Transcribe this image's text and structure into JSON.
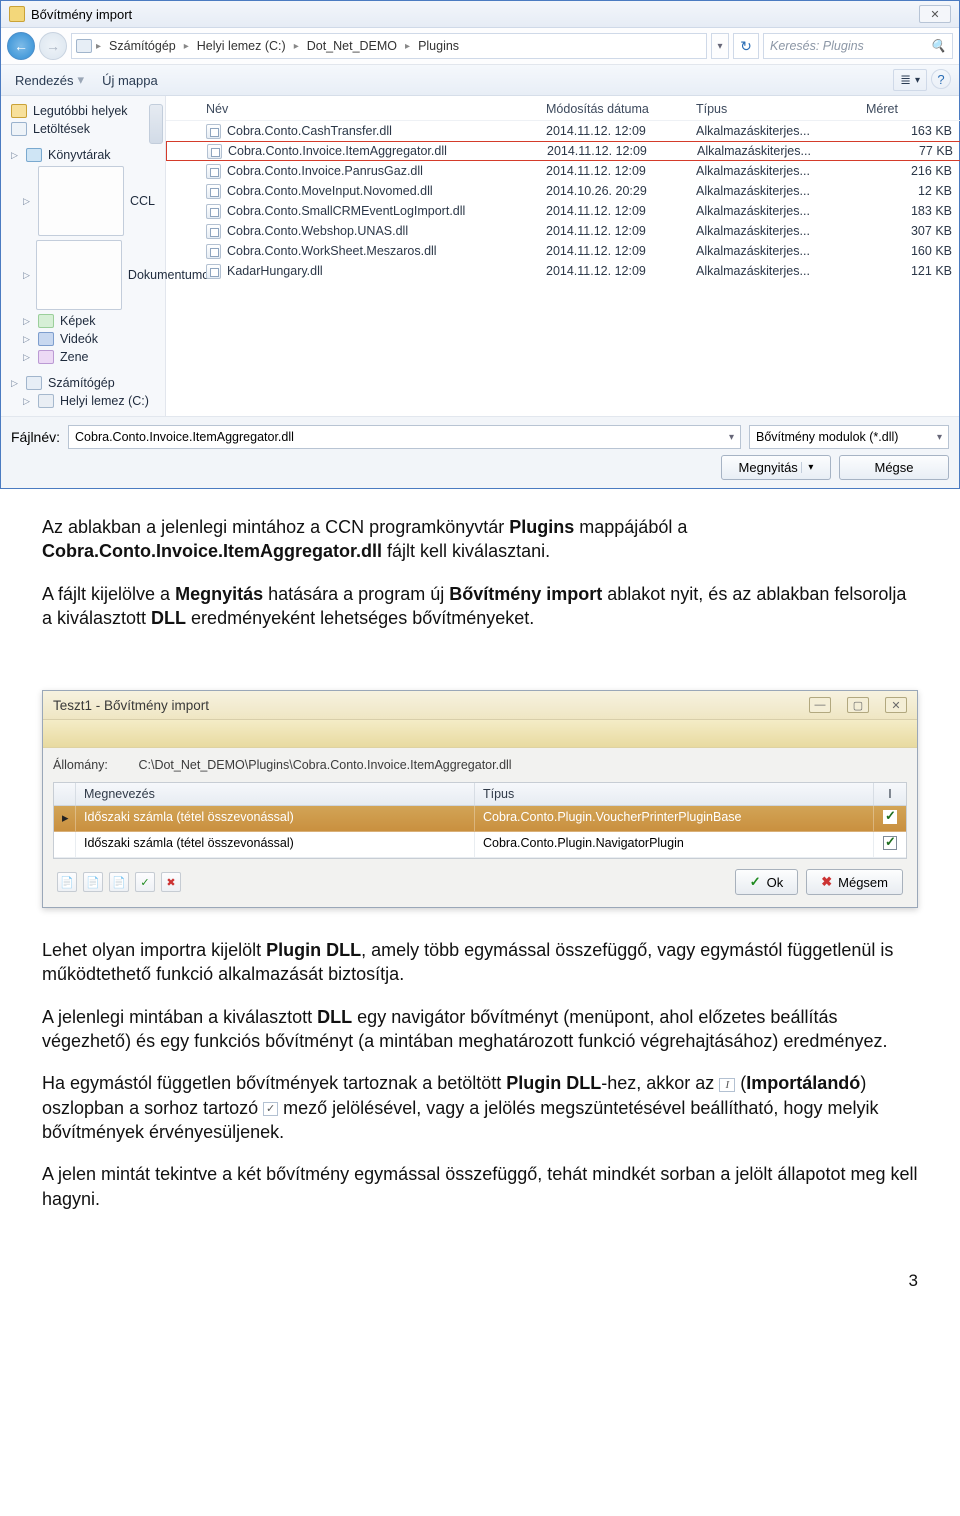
{
  "fileDialog": {
    "title": "Bővítmény import",
    "breadcrumbs": [
      "Számítógép",
      "Helyi lemez (C:)",
      "Dot_Net_DEMO",
      "Plugins"
    ],
    "searchPlaceholder": "Keresés: Plugins",
    "toolbar": {
      "organize": "Rendezés",
      "newFolder": "Új mappa"
    },
    "sidebar": {
      "recent": "Legutóbbi helyek",
      "downloads": "Letöltések",
      "libraries": "Könyvtárak",
      "libs": [
        "CCL",
        "Dokumentumok",
        "Képek",
        "Videók",
        "Zene"
      ],
      "computer": "Számítógép",
      "drive": "Helyi lemez (C:)"
    },
    "columns": {
      "name": "Név",
      "modified": "Módosítás dátuma",
      "type": "Típus",
      "size": "Méret"
    },
    "files": [
      {
        "name": "Cobra.Conto.CashTransfer.dll",
        "date": "2014.11.12. 12:09",
        "type": "Alkalmazáskiterjes...",
        "size": "163 KB",
        "selected": false
      },
      {
        "name": "Cobra.Conto.Invoice.ItemAggregator.dll",
        "date": "2014.11.12. 12:09",
        "type": "Alkalmazáskiterjes...",
        "size": "77 KB",
        "selected": true
      },
      {
        "name": "Cobra.Conto.Invoice.PanrusGaz.dll",
        "date": "2014.11.12. 12:09",
        "type": "Alkalmazáskiterjes...",
        "size": "216 KB",
        "selected": false
      },
      {
        "name": "Cobra.Conto.MoveInput.Novomed.dll",
        "date": "2014.10.26. 20:29",
        "type": "Alkalmazáskiterjes...",
        "size": "12 KB",
        "selected": false
      },
      {
        "name": "Cobra.Conto.SmallCRMEventLogImport.dll",
        "date": "2014.11.12. 12:09",
        "type": "Alkalmazáskiterjes...",
        "size": "183 KB",
        "selected": false
      },
      {
        "name": "Cobra.Conto.Webshop.UNAS.dll",
        "date": "2014.11.12. 12:09",
        "type": "Alkalmazáskiterjes...",
        "size": "307 KB",
        "selected": false
      },
      {
        "name": "Cobra.Conto.WorkSheet.Meszaros.dll",
        "date": "2014.11.12. 12:09",
        "type": "Alkalmazáskiterjes...",
        "size": "160 KB",
        "selected": false
      },
      {
        "name": "KadarHungary.dll",
        "date": "2014.11.12. 12:09",
        "type": "Alkalmazáskiterjes...",
        "size": "121 KB",
        "selected": false
      }
    ],
    "fileNameLabel": "Fájlnév:",
    "fileNameValue": "Cobra.Conto.Invoice.ItemAggregator.dll",
    "fileTypeValue": "Bővítmény modulok (*.dll)",
    "openBtn": "Megnyitás",
    "cancelBtn": "Mégse"
  },
  "doc": {
    "p1a": "Az ablakban a jelenlegi mintához a CCN programkönyvtár ",
    "p1b": "Plugins",
    "p1c": " mappájából a ",
    "p1d": "Cobra.Conto.Invoice.ItemAggregator.dll",
    "p1e": " fájlt kell kiválasztani.",
    "p2a": "A fájlt kijelölve a ",
    "p2b": "Megnyitás",
    "p2c": " hatására a program új ",
    "p2d": "Bővítmény import",
    "p2e": " ablakot nyit, és az ablakban felsorolja a kiválasztott ",
    "p2f": "DLL",
    "p2g": " eredményeként lehetséges bővítményeket.",
    "p3a": "Lehet olyan importra kijelölt ",
    "p3b": "Plugin DLL",
    "p3c": ", amely több egymással összefüggő, vagy egymástól függetlenül is működtethető funkció alkalmazását biztosítja.",
    "p4a": "A jelenlegi mintában a kiválasztott ",
    "p4b": "DLL",
    "p4c": " egy navigátor bővítményt (menüpont, ahol előzetes beállítás végezhető) és egy funkciós bővítményt (a mintában meghatározott funkció végrehajtásához) eredményez.",
    "p5a": "Ha egymástól független bővítmények tartoznak a betöltött ",
    "p5b": "Plugin DLL",
    "p5c": "-hez, akkor az ",
    "p5d": " (",
    "p5e": "Importálandó",
    "p5f": ") oszlopban a sorhoz tartozó ",
    "p5g": " mező jelölésével, vagy a jelölés megszüntetésével beállítható, hogy melyik bővítmények érvényesüljenek.",
    "p6": "A jelen mintát tekintve a két bővítmény egymással összefüggő, tehát mindkét sorban a jelölt állapotot meg kell hagyni.",
    "pageNum": "3"
  },
  "pluginWin": {
    "title": "Teszt1 - Bővítmény import",
    "pathLabel": "Állomány:",
    "pathValue": "C:\\Dot_Net_DEMO\\Plugins\\Cobra.Conto.Invoice.ItemAggregator.dll",
    "cols": {
      "name": "Megnevezés",
      "type": "Típus",
      "imp": "I"
    },
    "rows": [
      {
        "name": "Időszaki számla (tétel összevonással)",
        "type": "Cobra.Conto.Plugin.VoucherPrinterPluginBase",
        "checked": true,
        "selected": true
      },
      {
        "name": "Időszaki számla (tétel összevonással)",
        "type": "Cobra.Conto.Plugin.NavigatorPlugin",
        "checked": true,
        "selected": false
      }
    ],
    "okBtn": "Ok",
    "cancelBtn": "Mégsem"
  }
}
